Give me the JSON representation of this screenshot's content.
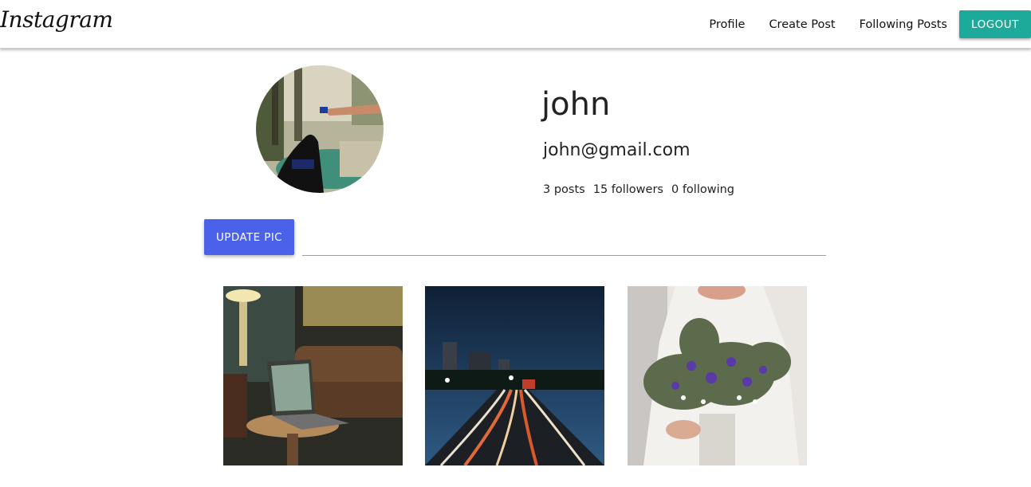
{
  "navbar": {
    "brand": "Instagram",
    "links": [
      "Profile",
      "Create Post",
      "Following Posts"
    ],
    "logout_label": "LOGOUT",
    "logout_color": "#1eaa9a"
  },
  "profile": {
    "username": "john",
    "email": "john@gmail.com",
    "stats": {
      "posts": "3 posts",
      "followers": "15 followers",
      "following": "0 following"
    },
    "update_pic_label": "UPDATE PIC",
    "update_pic_color": "#4a62ea"
  },
  "gallery": {
    "posts": [
      {
        "subject": "laptop on side table in lounge"
      },
      {
        "subject": "city highway night light trails"
      },
      {
        "subject": "person holding flower bouquet"
      }
    ]
  }
}
